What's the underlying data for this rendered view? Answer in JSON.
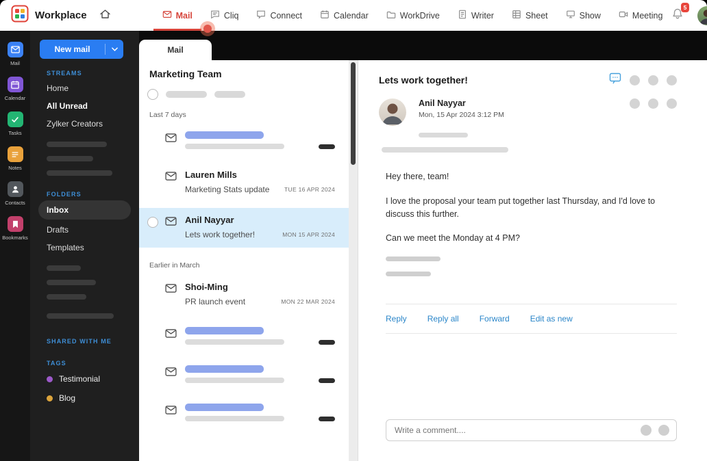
{
  "topbar": {
    "brand": "Workplace",
    "nav": [
      {
        "label": "Mail"
      },
      {
        "label": "Cliq"
      },
      {
        "label": "Connect"
      },
      {
        "label": "Calendar"
      },
      {
        "label": "WorkDrive"
      },
      {
        "label": "Writer"
      },
      {
        "label": "Sheet"
      },
      {
        "label": "Show"
      },
      {
        "label": "Meeting"
      }
    ],
    "notification_badge": "5"
  },
  "rail": {
    "items": [
      "Mail",
      "Calendar",
      "Tasks",
      "Notes",
      "Contacts",
      "Bookmarks"
    ]
  },
  "sidebar": {
    "new_mail_label": "New mail",
    "streams_title": "STREAMS",
    "streams": [
      "Home",
      "All Unread",
      "Zylker Creators"
    ],
    "folders_title": "FOLDERS",
    "folders": [
      "Inbox",
      "Drafts",
      "Templates"
    ],
    "shared_title": "SHARED WITH ME",
    "tags_title": "TAGS",
    "tags": [
      {
        "label": "Testimonial",
        "color": "#9c59c9"
      },
      {
        "label": "Blog",
        "color": "#dca43c"
      }
    ]
  },
  "list": {
    "tab": "Mail",
    "title": "Marketing Team",
    "group_recent": "Last 7 days",
    "group_earlier": "Earlier in March",
    "emails": [
      {
        "sender": "Lauren Mills",
        "subject": "Marketing Stats update",
        "date": "TUE 16 APR 2024"
      },
      {
        "sender": "Anil Nayyar",
        "subject": "Lets work together!",
        "date": "MON 15 APR 2024"
      },
      {
        "sender": "Shoi-Ming",
        "subject": "PR launch event",
        "date": "MON 22 MAR 2024"
      }
    ]
  },
  "reader": {
    "subject": "Lets work together!",
    "sender": "Anil Nayyar",
    "datetime": "Mon, 15 Apr 2024  3:12 PM",
    "body": [
      "Hey there, team!",
      "I love the proposal your team put together last Thursday, and I'd love to discuss this further.",
      "Can we meet the Monday at 4 PM?"
    ],
    "actions": [
      "Reply",
      "Reply all",
      "Forward",
      "Edit as new"
    ],
    "comment_placeholder": "Write a comment...."
  },
  "colors": {
    "accent_red": "#d6453b",
    "accent_blue": "#2a7df2",
    "selected_mail_bg": "#d8edfb"
  }
}
